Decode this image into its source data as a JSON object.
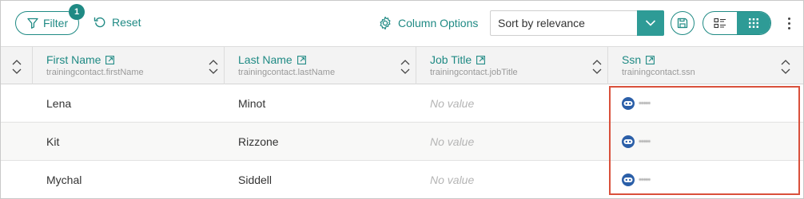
{
  "toolbar": {
    "filter_label": "Filter",
    "filter_count": "1",
    "reset_label": "Reset",
    "column_options_label": "Column Options",
    "sort_value": "Sort by relevance",
    "accent_color": "#1f8a84"
  },
  "columns": [
    {
      "title": "First Name",
      "field": "trainingcontact.firstName"
    },
    {
      "title": "Last Name",
      "field": "trainingcontact.lastName"
    },
    {
      "title": "Job Title",
      "field": "trainingcontact.jobTitle"
    },
    {
      "title": "Ssn",
      "field": "trainingcontact.ssn"
    }
  ],
  "rows": [
    {
      "first": "Lena",
      "last": "Minot",
      "job": "No value",
      "ssn": "•••••"
    },
    {
      "first": "Kit",
      "last": "Rizzone",
      "job": "No value",
      "ssn": "•••••"
    },
    {
      "first": "Mychal",
      "last": "Siddell",
      "job": "No value",
      "ssn": "•••••"
    }
  ],
  "icons": {
    "filter": "funnel-icon",
    "reset": "undo-icon",
    "column_options": "gear-icon",
    "sort_dropdown": "chevron-down-icon",
    "save": "floppy-disk-icon",
    "list_view": "list-view-icon",
    "grid_view": "grid-view-icon",
    "more": "vertical-ellipsis-icon",
    "external_link": "external-link-icon",
    "masked": "mask-icon"
  }
}
